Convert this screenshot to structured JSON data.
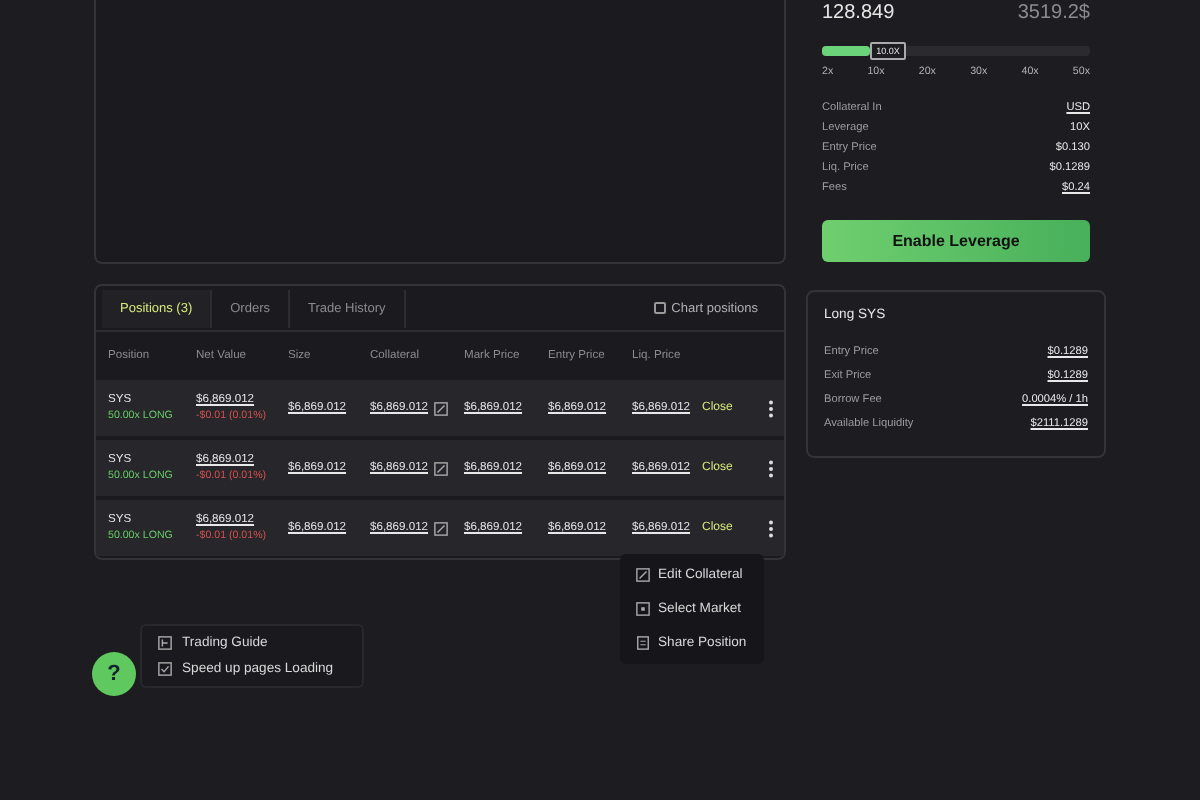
{
  "summary": {
    "amount": "128.849",
    "price": "3519.2$"
  },
  "leverage": {
    "level": 0.18,
    "badge": "10.0X",
    "ticks": [
      "2x",
      "10x",
      "20x",
      "30x",
      "40x",
      "50x"
    ]
  },
  "details": [
    {
      "label": "Collateral In",
      "value": "USD",
      "underlined": true
    },
    {
      "label": "Leverage",
      "value": "10X",
      "underlined": false
    },
    {
      "label": "Entry Price",
      "value": "$0.130",
      "underlined": false
    },
    {
      "label": "Liq. Price",
      "value": "$0.1289",
      "underlined": false
    },
    {
      "label": "Fees",
      "value": "$0.24",
      "underlined": true
    }
  ],
  "action_button": "Enable Leverage",
  "market_card": {
    "title": "Long SYS",
    "rows": [
      {
        "label": "Entry Price",
        "value": "$0.1289"
      },
      {
        "label": "Exit Price",
        "value": "$0.1289"
      },
      {
        "label": "Borrow Fee",
        "value": "0.0004% / 1h"
      },
      {
        "label": "Available Liquidity",
        "value": "$2111.1289"
      }
    ]
  },
  "positions": {
    "tabs": [
      {
        "label": "Positions (3)",
        "selected": true
      },
      {
        "label": "Orders",
        "selected": false
      },
      {
        "label": "Trade History",
        "selected": false
      }
    ],
    "chart_toggle": {
      "label": "Chart positions",
      "checked": false
    },
    "columns": [
      "Position",
      "Net Value",
      "Size",
      "Collateral",
      "Mark Price",
      "Entry Price",
      "Liq. Price"
    ],
    "rows": [
      {
        "market": "SYS",
        "side": "50.00x LONG",
        "net_value": "$6,869.012",
        "pnl": "-$0.01 (0.01%)",
        "size": "$6,869.012",
        "collateral": "$6,869.012",
        "mark_price": "$6,869.012",
        "entry_price": "$6,869.012",
        "liq_price": "$6,869.012",
        "action": "Close"
      },
      {
        "market": "SYS",
        "side": "50.00x LONG",
        "net_value": "$6,869.012",
        "pnl": "-$0.01 (0.01%)",
        "size": "$6,869.012",
        "collateral": "$6,869.012",
        "mark_price": "$6,869.012",
        "entry_price": "$6,869.012",
        "liq_price": "$6,869.012",
        "action": "Close"
      },
      {
        "market": "SYS",
        "side": "50.00x LONG",
        "net_value": "$6,869.012",
        "pnl": "-$0.01 (0.01%)",
        "size": "$6,869.012",
        "collateral": "$6,869.012",
        "mark_price": "$6,869.012",
        "entry_price": "$6,869.012",
        "liq_price": "$6,869.012",
        "action": "Close"
      }
    ]
  },
  "row_menu": [
    {
      "kind": "edit",
      "label": "Edit Collateral"
    },
    {
      "kind": "select",
      "label": "Select Market"
    },
    {
      "kind": "share",
      "label": "Share Position"
    }
  ],
  "help": {
    "button": "?",
    "items": [
      {
        "kind": "guide",
        "label": "Trading Guide"
      },
      {
        "kind": "speed",
        "label": "Speed up pages Loading"
      }
    ]
  }
}
